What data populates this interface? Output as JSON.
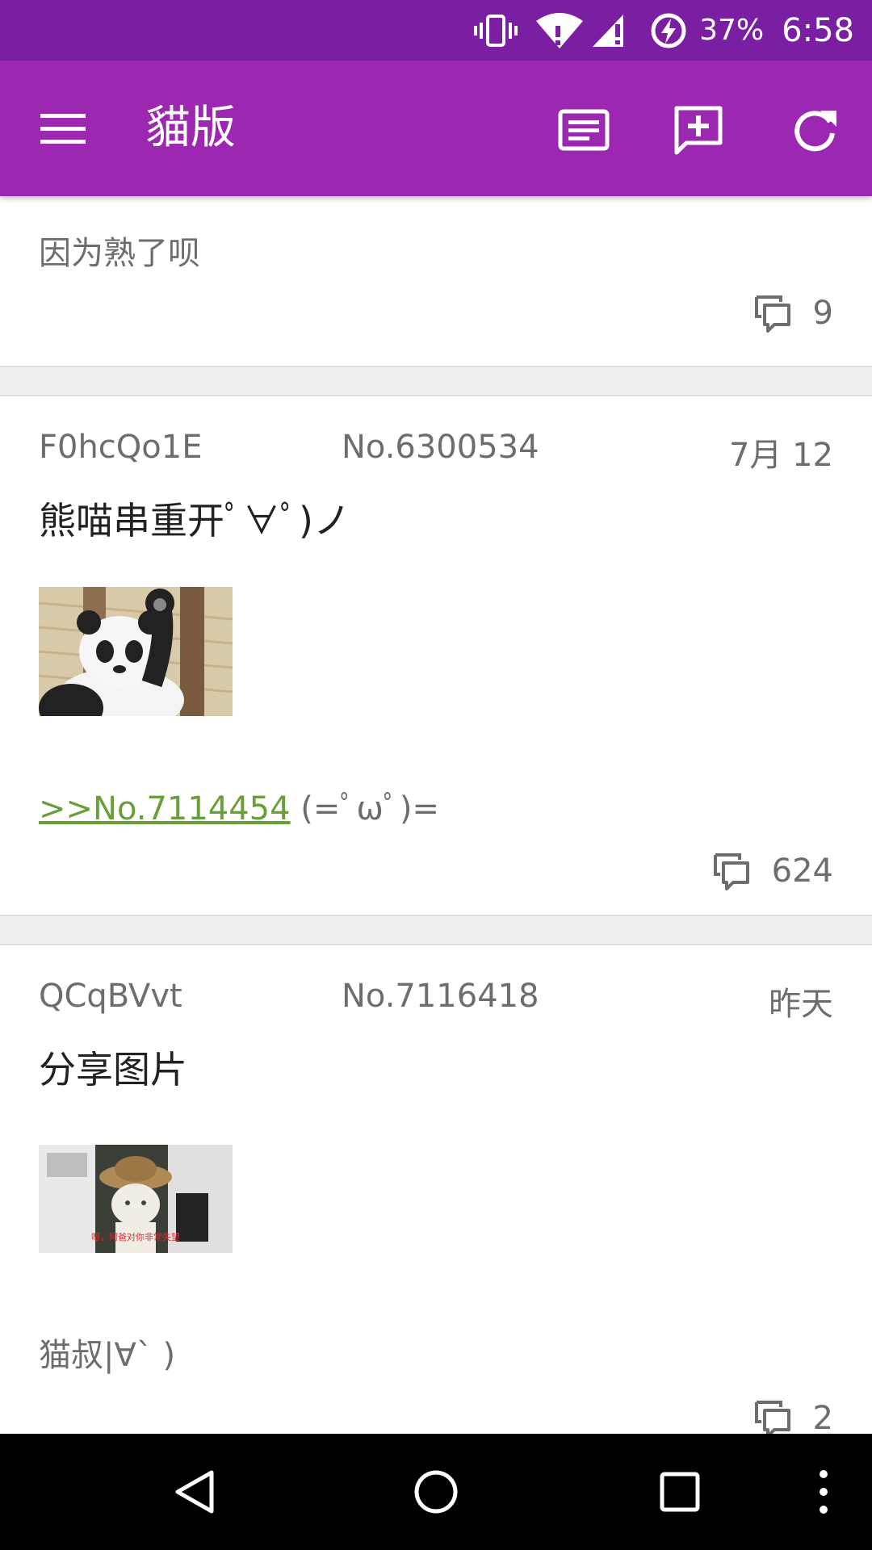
{
  "status_bar": {
    "battery_percent": "37%",
    "time": "6:58",
    "icons": [
      "vibrate-icon",
      "wifi-icon",
      "signal-icon",
      "battery-charging-icon"
    ]
  },
  "toolbar": {
    "title": "貓版",
    "actions": [
      "list-icon",
      "new-thread-icon",
      "refresh-icon"
    ]
  },
  "posts": [
    {
      "body": "因为熟了呗",
      "replies": "9"
    },
    {
      "user": "F0hcQo1E",
      "number": "No.6300534",
      "date": "7月 12",
      "title": "熊喵串重开ﾟ∀ﾟ)ノ",
      "quote_link": ">>No.7114454",
      "body_after_link": " (=ﾟωﾟ)=",
      "replies": "624"
    },
    {
      "user": "QCqBVvt",
      "number": "No.7116418",
      "date": "昨天",
      "title": "分享图片",
      "body": "猫叔|∀` )",
      "replies": "2"
    }
  ],
  "colors": {
    "status_bar": "#7b1fa2",
    "toolbar": "#9c27b0",
    "link": "#689f38"
  }
}
